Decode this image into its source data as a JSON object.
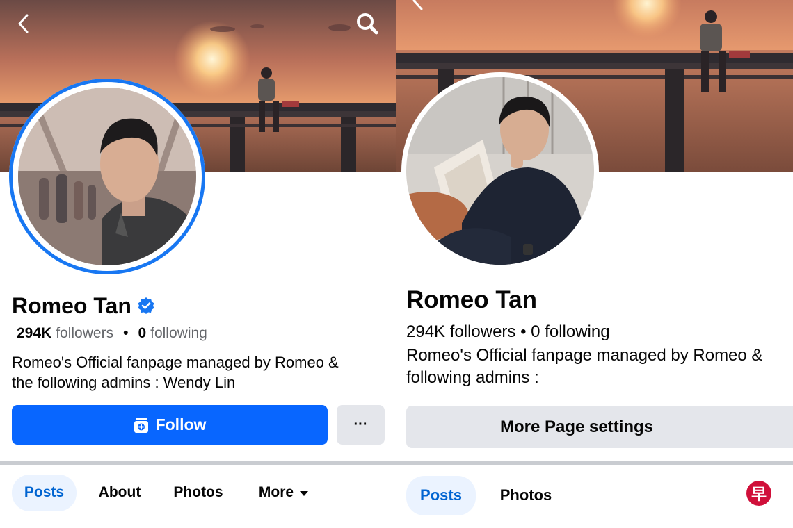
{
  "left": {
    "profile": {
      "name": "Romeo Tan",
      "followers_count": "294K",
      "followers_label": "followers",
      "following_count": "0",
      "following_label": "following",
      "separator": "•",
      "bio": "Romeo's Official fanpage managed by Romeo &\nthe following admins :  Wendy Lin"
    },
    "actions": {
      "follow_label": "Follow",
      "more_label": "···"
    },
    "tabs": [
      {
        "label": "Posts",
        "active": true
      },
      {
        "label": "About",
        "active": false
      },
      {
        "label": "Photos",
        "active": false
      },
      {
        "label": "More",
        "active": false
      }
    ]
  },
  "right": {
    "profile": {
      "name": "Romeo Tan",
      "stats_line": "294K followers • 0 following",
      "bio": "Romeo's Official fanpage managed by Romeo &\nfollowing admins :"
    },
    "actions": {
      "settings_label": "More Page settings"
    },
    "tabs": [
      {
        "label": "Posts",
        "active": true
      },
      {
        "label": "Photos",
        "active": false
      }
    ]
  },
  "watermark": {
    "label": "早"
  },
  "colors": {
    "brand_blue": "#0866ff",
    "story_ring": "#1877f2",
    "active_tab_bg": "#ebf3ff",
    "active_tab_text": "#0064d1",
    "button_gray": "#e4e6eb",
    "text_secondary": "#65676b"
  },
  "icons": {
    "back": "chevron-left-icon",
    "search": "search-icon",
    "verified": "verified-badge-icon",
    "follow": "follow-page-icon",
    "more_caret": "caret-down-icon"
  }
}
